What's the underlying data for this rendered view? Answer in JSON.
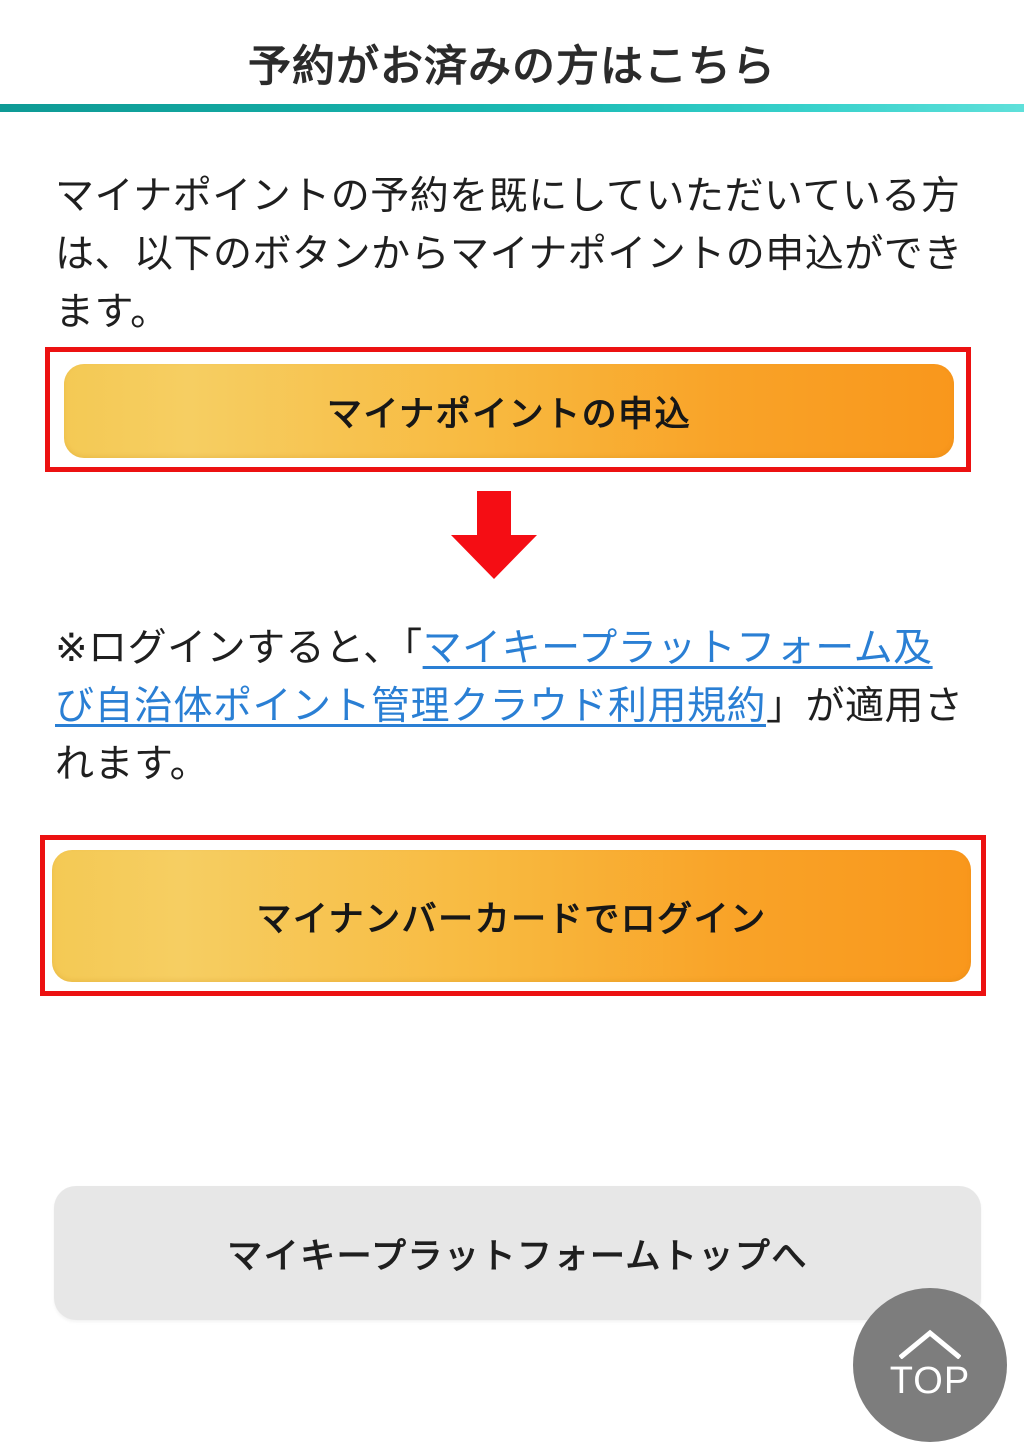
{
  "header": {
    "title": "予約がお済みの方はこちら",
    "rule_color_left": "#0e9a95",
    "rule_color_right": "#5fe0da"
  },
  "intro": {
    "text": "マイナポイントの予約を既にしていただいている方は、以下のボタンからマイナポイントの申込ができます。"
  },
  "apply_section": {
    "button_label": "マイナポイントの申込",
    "annotation_color": "#ec1111",
    "button_gradient_from": "#f4c954",
    "button_gradient_to": "#f9971c"
  },
  "arrow": {
    "icon": "arrow-down-icon",
    "color": "#f50d14"
  },
  "terms": {
    "prefix": "※ログインすると、「",
    "link_text": "マイキープラットフォーム及び自治体ポイント管理クラウド利用規約",
    "suffix": "」が適用されます。",
    "link_color": "#2a7fd4"
  },
  "login_section": {
    "button_label": "マイナンバーカードでログイン",
    "annotation_color": "#ec1111",
    "button_gradient_from": "#f4c954",
    "button_gradient_to": "#f9971c"
  },
  "platform_top": {
    "button_label": "マイキープラットフォームトップへ",
    "background_color": "#e7e7e7"
  },
  "top_button": {
    "label": "TOP",
    "icon": "chevron-up-icon",
    "background_color": "#7d7d7d"
  }
}
